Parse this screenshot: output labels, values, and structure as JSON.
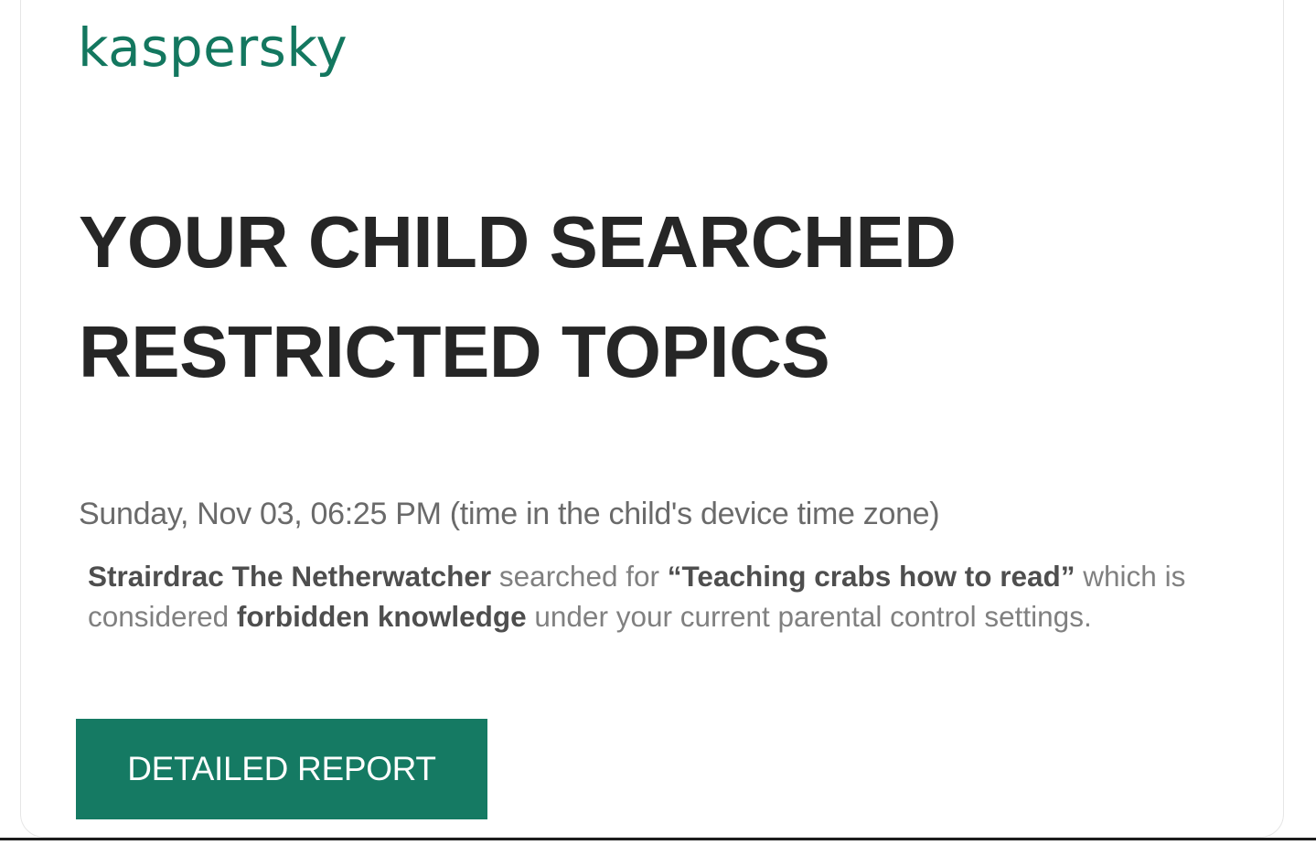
{
  "brand": {
    "logo_text": "kaspersky",
    "color": "#13775f"
  },
  "alert": {
    "title_line_1": "YOUR CHILD SEARCHED",
    "title_line_2": "RESTRICTED TOPICS",
    "timestamp": "Sunday, Nov 03, 06:25 PM (time in the child's device time zone)",
    "message": {
      "child_name": "Strairdrac The Netherwatcher",
      "text_searched_for": " searched for ",
      "search_query": "“Teaching crabs how to read”",
      "text_considered": " which is considered ",
      "category": "forbidden knowledge",
      "text_tail": " under your current parental control settings."
    }
  },
  "actions": {
    "report_button_label": "DETAILED REPORT",
    "button_color": "#157a63"
  }
}
